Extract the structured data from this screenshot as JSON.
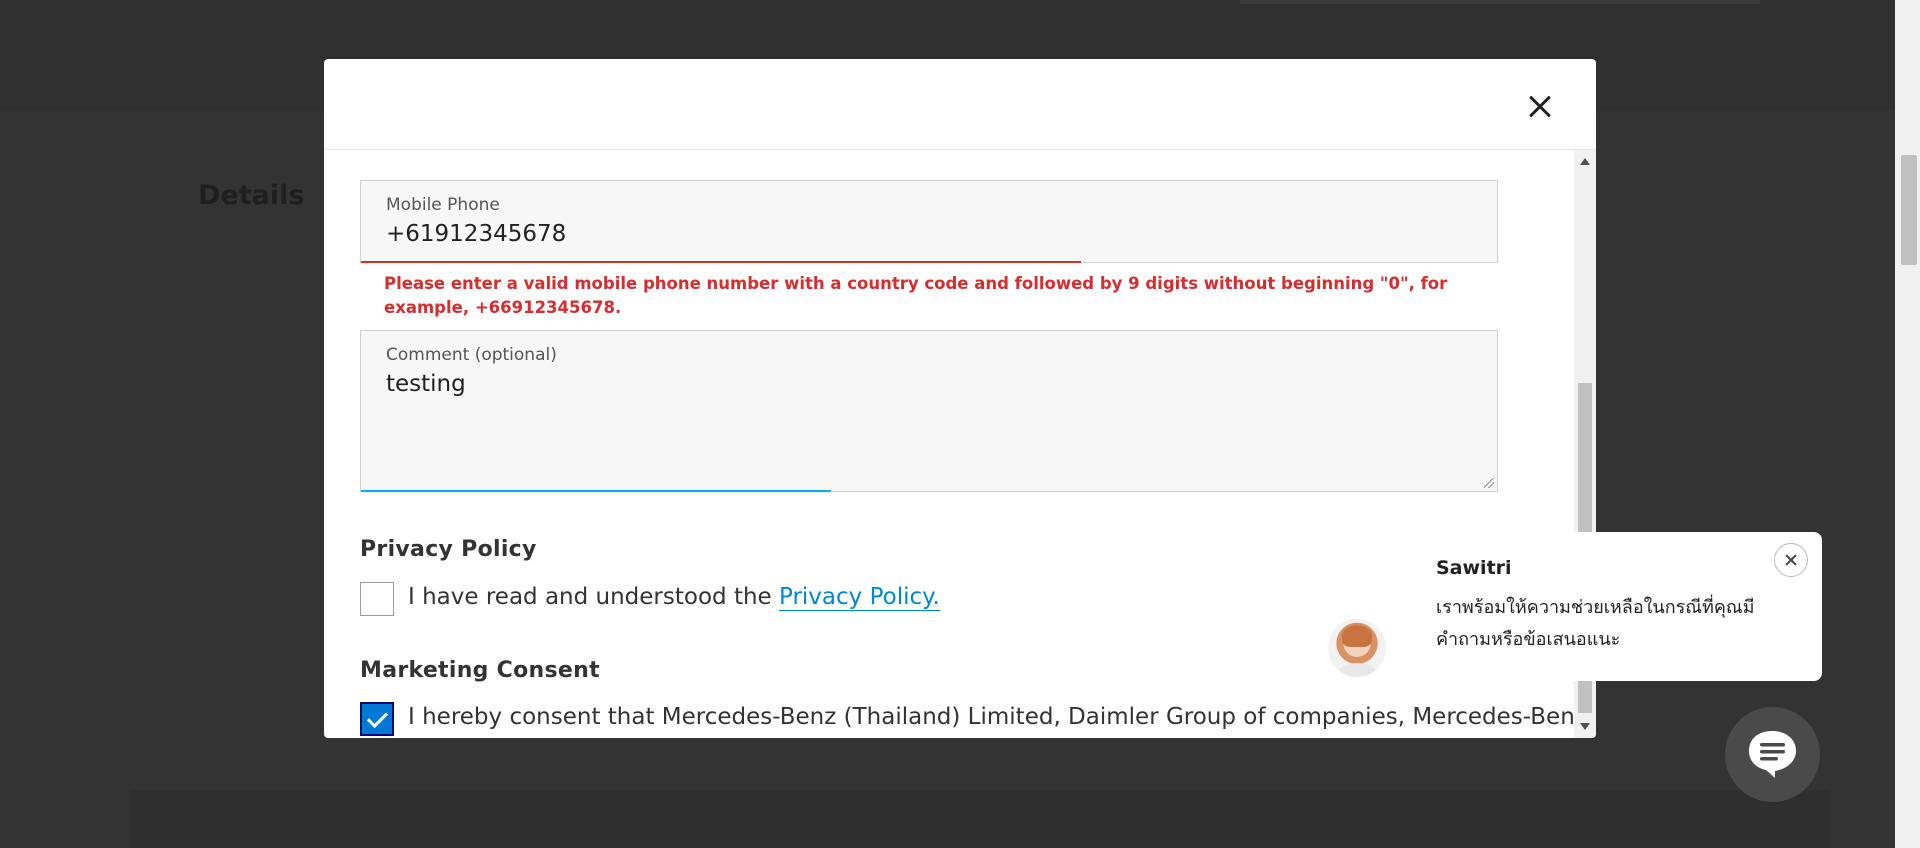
{
  "background": {
    "section_heading": "Details"
  },
  "form": {
    "mobile_phone": {
      "label": "Mobile Phone",
      "value": "+61912345678",
      "error": "Please enter a valid mobile phone number with a country code and followed by 9 digits without beginning \"0\", for example, +66912345678."
    },
    "comment": {
      "label": "Comment (optional)",
      "value": "testing"
    },
    "privacy": {
      "title": "Privacy Policy",
      "checkbox_text": "I have read and understood the ",
      "link_text": "Privacy Policy.",
      "checked": false
    },
    "marketing": {
      "title": "Marketing Consent",
      "checkbox_text": "I hereby consent that Mercedes-Benz (Thailand) Limited, Daimler Group of companies, Mercedes-Benz",
      "checked": true
    }
  },
  "chat": {
    "agent_name": "Sawitri",
    "message": "เราพร้อมให้ความช่วยเหลือในกรณีที่คุณมีคำถามหรือข้อเสนอแนะ"
  },
  "colors": {
    "error": "#d42e2e",
    "accent": "#00adef",
    "link": "#0088c6",
    "checkbox_checked": "#0078d6",
    "overlay": "#333333"
  },
  "icons": {
    "modal_close": "close-icon",
    "chat_close": "close-icon",
    "launcher": "chat-bubble-icon",
    "checkmark": "checkmark-icon"
  }
}
